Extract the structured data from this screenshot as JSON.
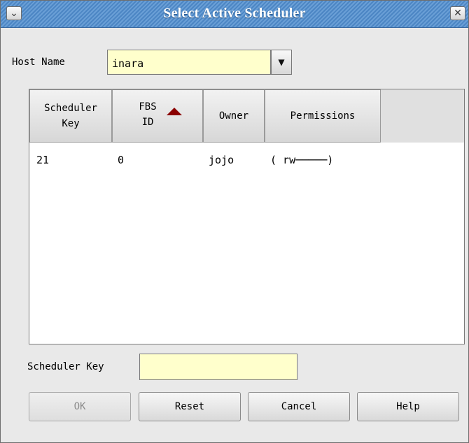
{
  "window": {
    "title": "Select Active Scheduler"
  },
  "titlebar": {
    "menu_glyph": "⌄",
    "close_glyph": "✕"
  },
  "host": {
    "label": "Host Name",
    "value": "inara",
    "dropdown_glyph": "▼"
  },
  "table": {
    "columns": [
      {
        "label": "Scheduler\nKey"
      },
      {
        "label": "FBS\nID",
        "sort": "ascending"
      },
      {
        "label": "Owner"
      },
      {
        "label": "Permissions"
      }
    ],
    "rows": [
      {
        "key": "21",
        "fbs_id": "0",
        "owner": "jojo",
        "permissions": "( rw─────)"
      }
    ],
    "sort_color": "#8b0000"
  },
  "scheduler_key": {
    "label": "Scheduler Key",
    "value": ""
  },
  "buttons": {
    "ok": "OK",
    "reset": "Reset",
    "cancel": "Cancel",
    "help": "Help"
  },
  "colors": {
    "titlebar": "#5a93cf",
    "input_bg": "#ffffcc",
    "window_bg": "#e9e9e9"
  }
}
